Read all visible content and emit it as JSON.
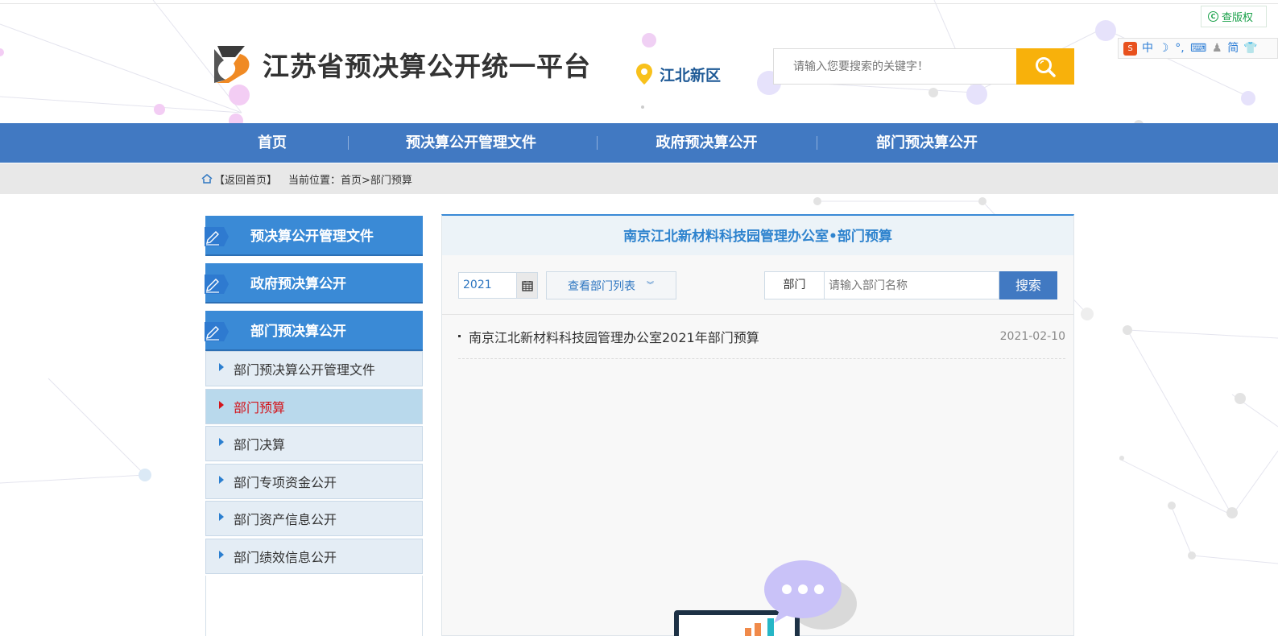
{
  "header": {
    "site_title": "江苏省预决算公开统一平台",
    "region": "江北新区",
    "search_placeholder": "请输入您要搜索的关键字！",
    "copyright_label": "查版权",
    "accessibility_tools": [
      "中",
      "简"
    ]
  },
  "nav": {
    "items": [
      "首页",
      "预决算公开管理文件",
      "政府预决算公开",
      "部门预决算公开"
    ]
  },
  "breadcrumb": {
    "back_home": "【返回首页】",
    "location_label": "当前位置：首页>部门预算"
  },
  "sidebar": {
    "sections": [
      "预决算公开管理文件",
      "政府预决算公开",
      "部门预决算公开"
    ],
    "sub_items": [
      {
        "label": "部门预决算公开管理文件",
        "active": false
      },
      {
        "label": "部门预算",
        "active": true
      },
      {
        "label": "部门决算",
        "active": false
      },
      {
        "label": "部门专项资金公开",
        "active": false
      },
      {
        "label": "部门资产信息公开",
        "active": false
      },
      {
        "label": "部门绩效信息公开",
        "active": false
      }
    ]
  },
  "main": {
    "title": "南京江北新材料科技园管理办公室•部门预算",
    "year": "2021",
    "dept_list_label": "查看部门列表",
    "dept_tag": "部门",
    "dept_placeholder": "请输入部门名称",
    "search_button": "搜索",
    "documents": [
      {
        "title": "南京江北新材料科技园管理办公室2021年部门预算",
        "date": "2021-02-10"
      }
    ]
  },
  "colors": {
    "nav_blue": "#4179c2",
    "side_blue": "#3a8ad6",
    "search_orange": "#f8b10b",
    "active_red": "#d3131a"
  }
}
